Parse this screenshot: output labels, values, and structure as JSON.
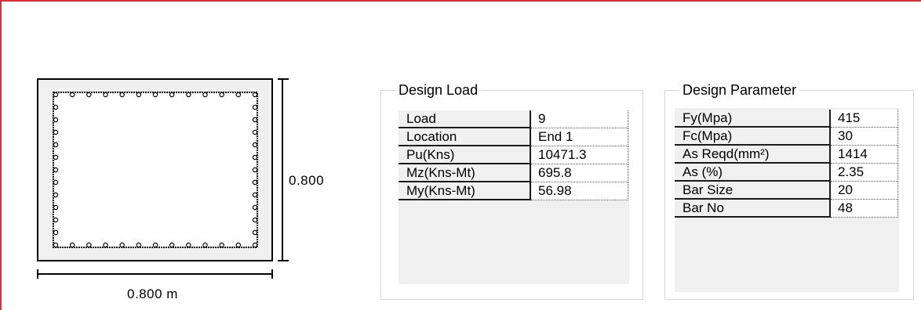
{
  "section": {
    "height_label": "0.800",
    "width_label": "0.800 m"
  },
  "design_load": {
    "title": "Design Load",
    "rows": [
      {
        "label": "Load",
        "value": "9"
      },
      {
        "label": "Location",
        "value": "End 1"
      },
      {
        "label": "Pu(Kns)",
        "value": "10471.3"
      },
      {
        "label": "Mz(Kns-Mt)",
        "value": "695.8"
      },
      {
        "label": "My(Kns-Mt)",
        "value": "56.98"
      }
    ]
  },
  "design_parameter": {
    "title": "Design Parameter",
    "rows": [
      {
        "label": "Fy(Mpa)",
        "value": "415"
      },
      {
        "label": "Fc(Mpa)",
        "value": "30"
      },
      {
        "label": "As Reqd(mm²)",
        "value": "1414"
      },
      {
        "label": "As (%)",
        "value": "2.35"
      },
      {
        "label": "Bar Size",
        "value": "20"
      },
      {
        "label": "Bar No",
        "value": "48"
      }
    ]
  },
  "colors": {
    "border_accent": "#d8303a",
    "grid_background": "#f0f0f0"
  }
}
